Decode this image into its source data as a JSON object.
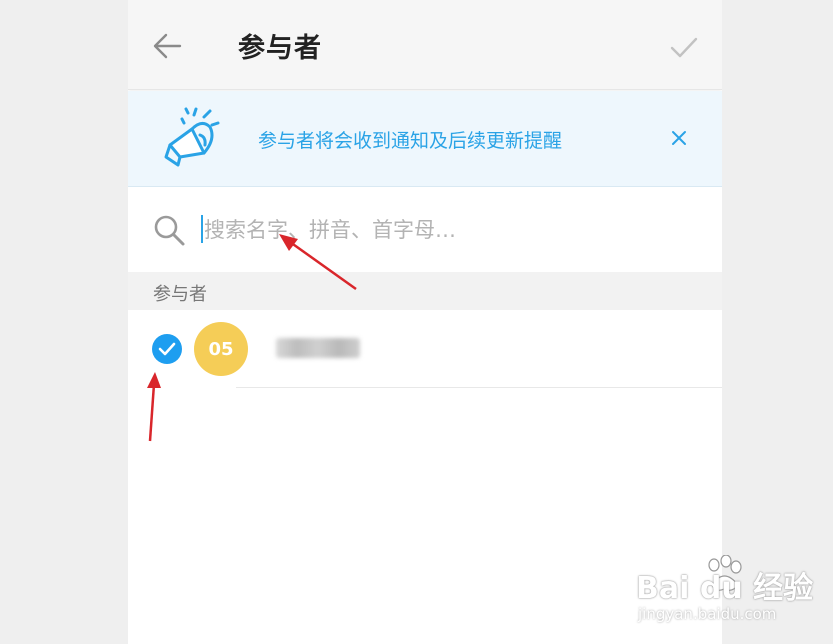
{
  "header": {
    "title": "参与者",
    "back_icon": "arrow-left-icon",
    "confirm_icon": "checkmark-icon"
  },
  "notice": {
    "text": "参与者将会收到通知及后续更新提醒",
    "icon": "megaphone-icon",
    "close_icon": "close-icon",
    "accent_color": "#2aa3e6"
  },
  "search": {
    "placeholder": "搜索名字、拼音、首字母…",
    "value": "",
    "icon": "search-icon"
  },
  "section": {
    "label": "参与者"
  },
  "participants": [
    {
      "avatar_text": "05",
      "avatar_color": "#f5cd57",
      "selected": true,
      "check_color": "#1e9ef0"
    }
  ],
  "annotations": {
    "arrow_color": "#d9262b"
  },
  "watermark": {
    "brand": "Bai du 经验",
    "url": "jingyan.baidu.com"
  }
}
